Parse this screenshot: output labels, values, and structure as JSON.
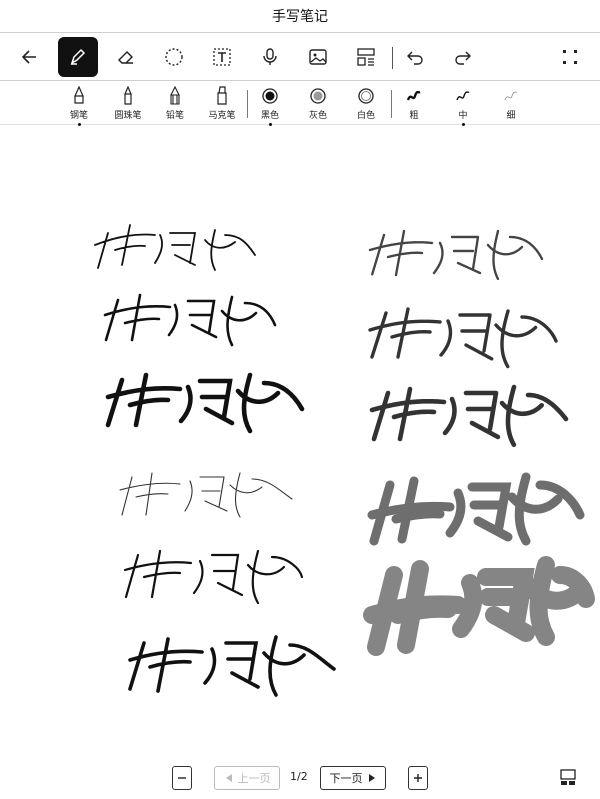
{
  "window": {
    "title": "手写笔记"
  },
  "toolbar": {
    "items": [
      "back-icon",
      "pen-icon",
      "eraser-icon",
      "lasso-icon",
      "text-box-icon",
      "microphone-icon",
      "image-icon",
      "layout-icon",
      "undo-icon",
      "redo-icon",
      "more-icon"
    ]
  },
  "pen_bar": {
    "pens": [
      {
        "label": "钢笔",
        "selected": true
      },
      {
        "label": "圆珠笔",
        "selected": false
      },
      {
        "label": "铅笔",
        "selected": false
      },
      {
        "label": "马克笔",
        "selected": false
      }
    ],
    "colors": [
      {
        "label": "黑色",
        "selected": true
      },
      {
        "label": "灰色",
        "selected": false
      },
      {
        "label": "白色",
        "selected": false
      }
    ],
    "widths": [
      {
        "label": "粗",
        "selected": false
      },
      {
        "label": "中",
        "selected": true
      },
      {
        "label": "细",
        "selected": false
      }
    ]
  },
  "footer": {
    "prev_label": "上一页",
    "page_indicator": "1/2",
    "next_label": "下一页"
  }
}
